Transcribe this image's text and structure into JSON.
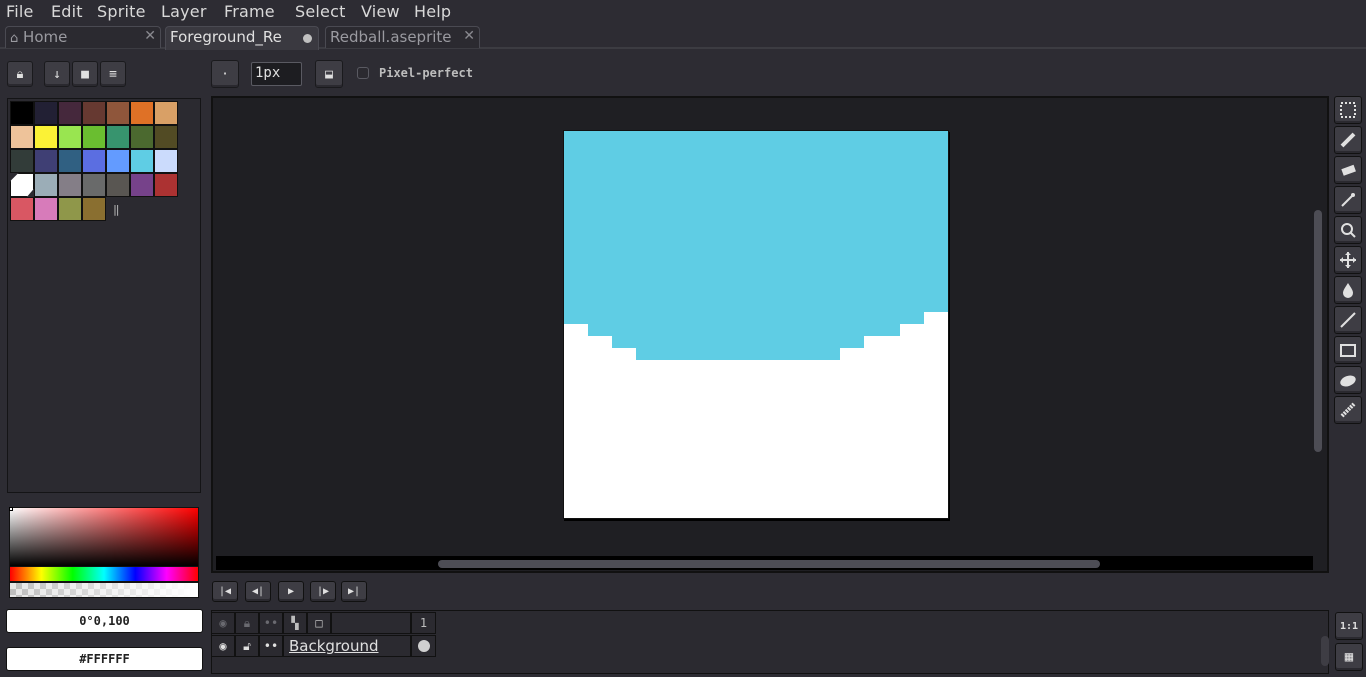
{
  "menu": {
    "file": "File",
    "edit": "Edit",
    "sprite": "Sprite",
    "layer": "Layer",
    "frame": "Frame",
    "select": "Select",
    "view": "View",
    "help": "Help"
  },
  "tabs": [
    {
      "label": "Home"
    },
    {
      "label": "Foreground_Re"
    },
    {
      "label": "Redball.aseprite"
    }
  ],
  "toolbar": {
    "brush_size": "1px",
    "pixel_perfect_label": "Pixel-perfect",
    "pixel_perfect_checked": false
  },
  "palette": {
    "colors": [
      "#000000",
      "#222034",
      "#45283c",
      "#663931",
      "#8f563b",
      "#df7126",
      "#d9a066",
      "#eec39a",
      "#fbf236",
      "#99e550",
      "#6abe30",
      "#37946e",
      "#4b692f",
      "#524b24",
      "#323c39",
      "#3f3f74",
      "#306082",
      "#5b6ee1",
      "#639bff",
      "#5fcde4",
      "#cbdbfc",
      "#ffffff",
      "#9badb7",
      "#847e87",
      "#696a6a",
      "#595652",
      "#76428a",
      "#ac3232",
      "#d95763",
      "#d77bba",
      "#8f974a",
      "#8a6f30"
    ],
    "selected_index": 21
  },
  "colorbar": {
    "hsv_value": "0°0,100",
    "hex_value": "#FFFFFF"
  },
  "sprite": {
    "sky_color": "#5fcde4",
    "ground_color": "#ffffff"
  },
  "timeline": {
    "frame_number": "1",
    "layer_name": "Background"
  },
  "statusbar": {
    "zoom_label": "1:1"
  }
}
